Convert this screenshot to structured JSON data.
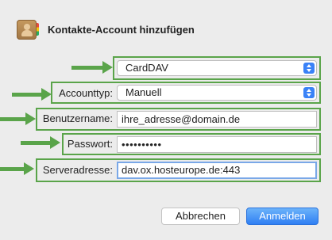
{
  "dialog": {
    "title": "Kontakte-Account hinzufügen",
    "app_icon": "contacts-app-icon"
  },
  "form": {
    "account_type_select": {
      "value": "CardDAV"
    },
    "account_mode": {
      "label": "Accounttyp:",
      "value": "Manuell"
    },
    "username": {
      "label": "Benutzername:",
      "value": "ihre_adresse@domain.de"
    },
    "password": {
      "label": "Passwort:",
      "value": "••••••••••"
    },
    "server": {
      "label": "Serveradresse:",
      "value": "dav.ox.hosteurope.de:443"
    }
  },
  "buttons": {
    "cancel": "Abbrechen",
    "ok": "Anmelden"
  },
  "annotation_color": "#5aa44a",
  "accent_color": "#3a82f7"
}
